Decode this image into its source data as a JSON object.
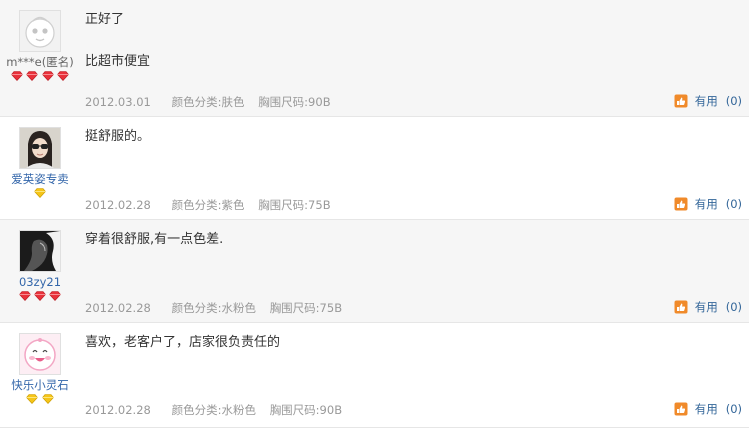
{
  "reviews": [
    {
      "user": {
        "name": "m***e(匿名)",
        "avatar": "anonymous-face-avatar",
        "rank_icon": "red-diamond-icon",
        "rank_count": 4
      },
      "comment": [
        "正好了",
        "比超市便宜"
      ],
      "date": "2012.03.01",
      "sku": {
        "color": "颜色分类:肤色",
        "size": "胸围尺码:90B"
      },
      "useful": {
        "label": "有用",
        "count": "(0)"
      }
    },
    {
      "user": {
        "name": "爱英姿专卖",
        "avatar": "girl-photo-avatar",
        "rank_icon": "gold-diamond-icon",
        "rank_count": 1
      },
      "comment": [
        "挺舒服的。"
      ],
      "date": "2012.02.28",
      "sku": {
        "color": "颜色分类:紫色",
        "size": "胸围尺码:75B"
      },
      "useful": {
        "label": "有用",
        "count": "(0)"
      }
    },
    {
      "user": {
        "name": "03zy21",
        "avatar": "dark-silhouette-avatar",
        "rank_icon": "red-diamond-icon",
        "rank_count": 3
      },
      "comment": [
        "穿着很舒服,有一点色差."
      ],
      "date": "2012.02.28",
      "sku": {
        "color": "颜色分类:水粉色",
        "size": "胸围尺码:75B"
      },
      "useful": {
        "label": "有用",
        "count": "(0)"
      }
    },
    {
      "user": {
        "name": "快乐小灵石",
        "avatar": "pink-cartoon-avatar",
        "rank_icon": "gold-diamond-icon",
        "rank_count": 2
      },
      "comment": [
        "喜欢，老客户了，店家很负责任的"
      ],
      "date": "2012.02.28",
      "sku": {
        "color": "颜色分类:水粉色",
        "size": "胸围尺码:90B"
      },
      "useful": {
        "label": "有用",
        "count": "(0)"
      }
    }
  ],
  "colors": {
    "username": "#3366aa",
    "meta_text": "#999999",
    "useful_link": "#336699",
    "thumb_icon": "#f08a2a",
    "red_diamond": "#e8303a",
    "gold_diamond": "#f5c518",
    "alt_row_bg": "#f6f6f6"
  }
}
